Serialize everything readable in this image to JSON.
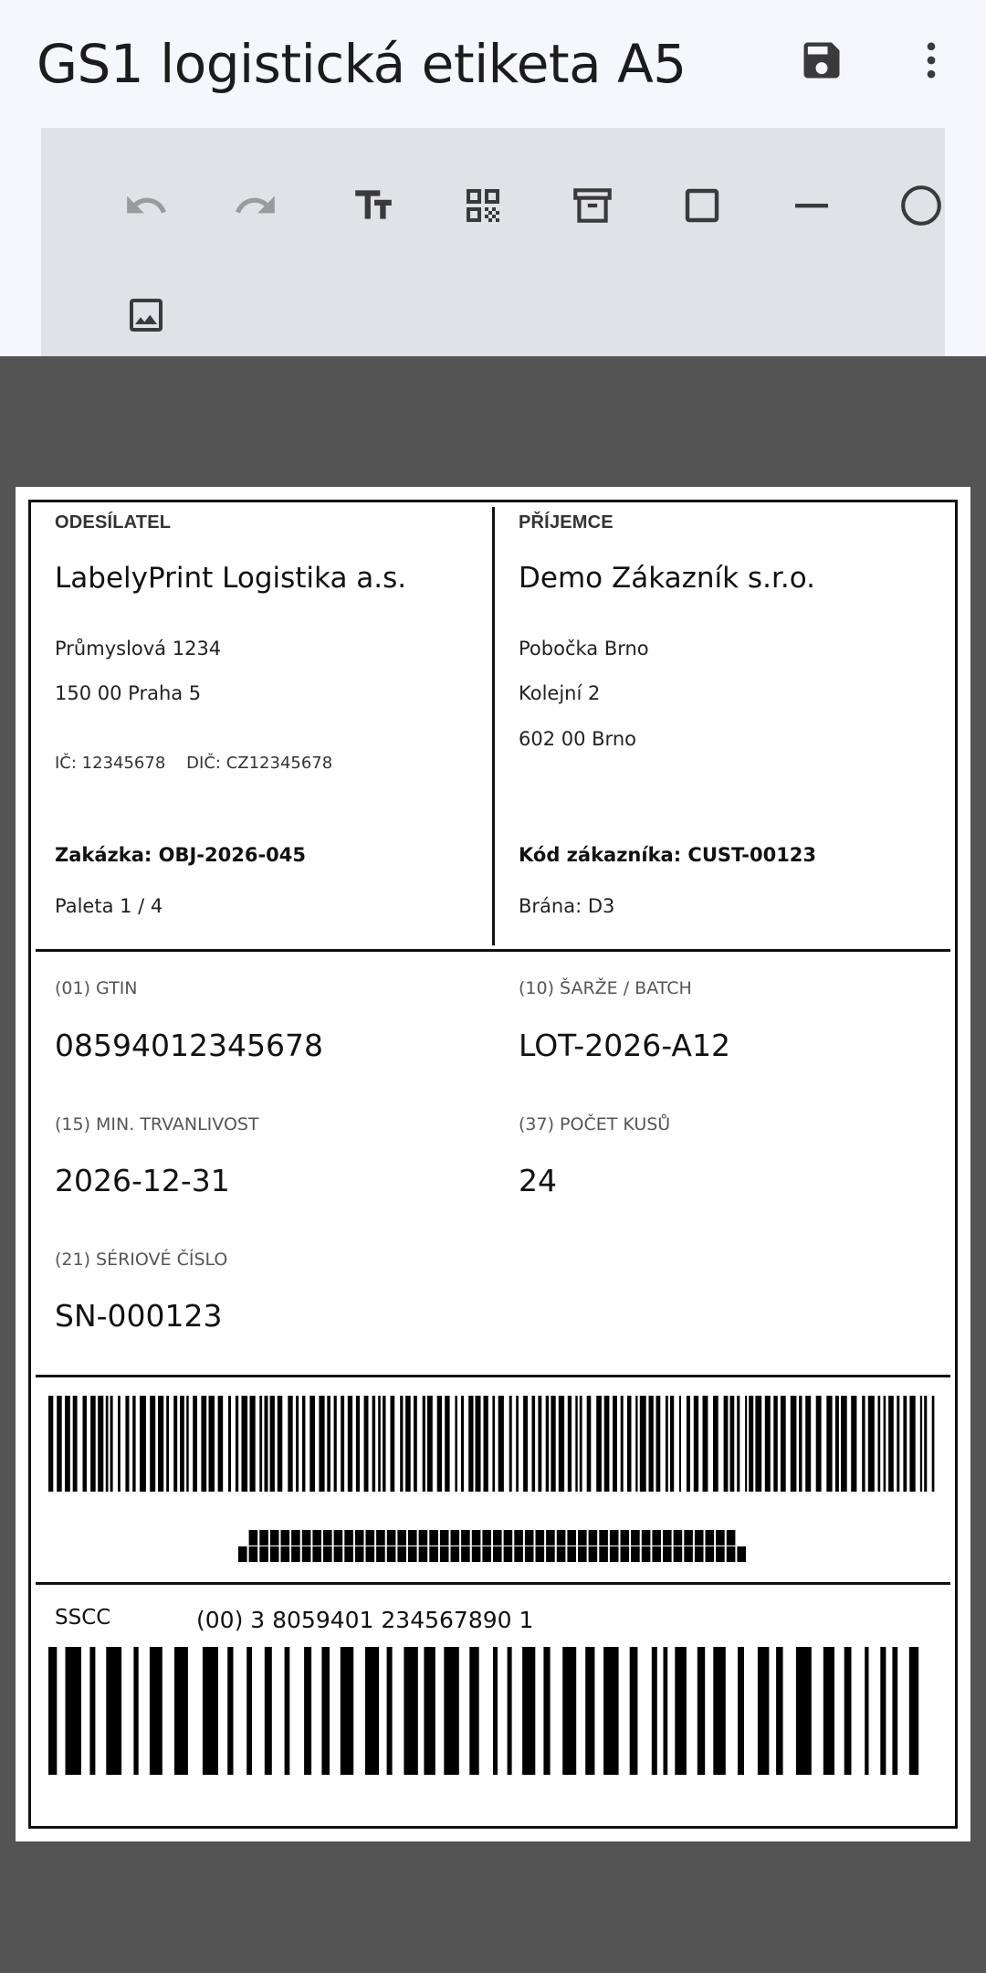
{
  "app": {
    "title": "GS1 logistická etiketa A5"
  },
  "icons": {
    "save": "save-icon",
    "more": "more-vert-icon"
  },
  "toolbar": {
    "tools": [
      {
        "id": "undo",
        "icon": "undo-icon",
        "enabled": false
      },
      {
        "id": "redo",
        "icon": "redo-icon",
        "enabled": false
      },
      {
        "id": "text",
        "icon": "text-fields-icon",
        "enabled": true
      },
      {
        "id": "qr",
        "icon": "qr-code-icon",
        "enabled": true
      },
      {
        "id": "archive",
        "icon": "archive-box-icon",
        "enabled": true
      },
      {
        "id": "rectangle",
        "icon": "rectangle-icon",
        "enabled": true
      },
      {
        "id": "line",
        "icon": "line-icon",
        "enabled": true
      },
      {
        "id": "circle",
        "icon": "circle-icon",
        "enabled": true
      },
      {
        "id": "image",
        "icon": "image-icon",
        "enabled": true
      }
    ]
  },
  "colors": {
    "appbar_bg": "#f6f7fd",
    "toolbar_bg": "#e1e2e7",
    "canvas_bg": "#545454",
    "label_bg": "#ffffff",
    "icon_dark": "#3a3a3c",
    "icon_disabled": "#9a9a9f"
  },
  "label": {
    "sender": {
      "heading": "ODESÍLATEL",
      "name": "LabelyPrint Logistika a.s.",
      "street": "Průmyslová 1234",
      "city": "150 00 Praha 5",
      "ids": "IČ: 12345678    DIČ: CZ12345678",
      "order": "Zakázka: OBJ-2026-045",
      "pallet": "Paleta 1 / 4"
    },
    "recipient": {
      "heading": "PŘÍJEMCE",
      "name": "Demo Zákazník s.r.o.",
      "line1": "Pobočka Brno",
      "line2": "Kolejní 2",
      "line3": "602 00 Brno",
      "customer": "Kód zákazníka: CUST-00123",
      "gate": "Brána: D3"
    },
    "fields": {
      "gtin_label": "(01) GTIN",
      "gtin_value": "08594012345678",
      "batch_label": "(10) ŠARŽE / BATCH",
      "batch_value": "LOT-2026-A12",
      "bestbefore_label": "(15) MIN. TRVANLIVOST",
      "bestbefore_value": "2026-12-31",
      "count_label": "(37) POČET KUSŮ",
      "count_value": "24",
      "serial_label": "(21) SÉRIOVÉ ČÍSLO",
      "serial_value": "SN-000123"
    },
    "sscc": {
      "label": "SSCC",
      "value": "(00) 3 8059401 234567890 1"
    }
  }
}
